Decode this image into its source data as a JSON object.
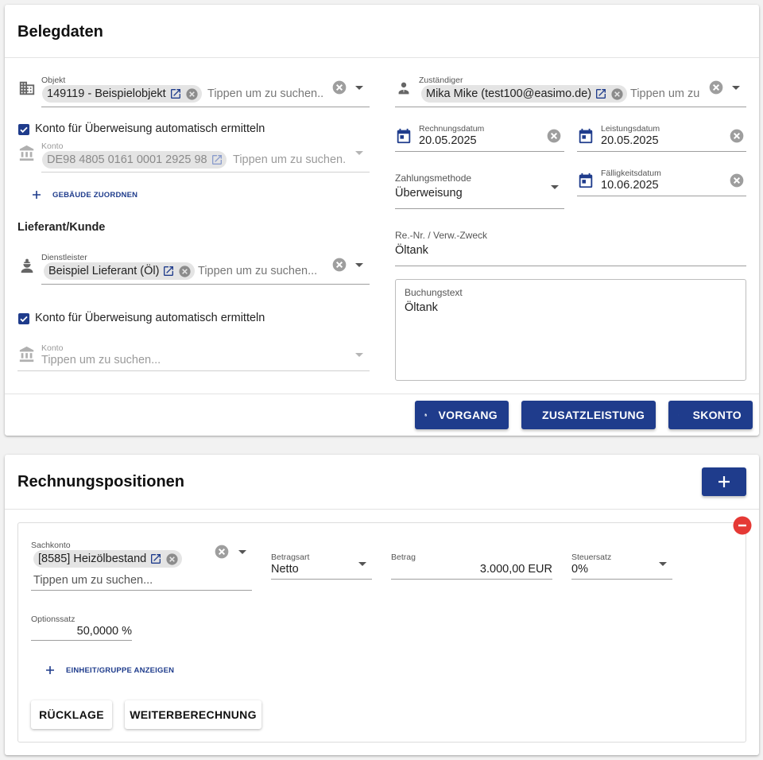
{
  "belegdaten": {
    "title": "Belegdaten",
    "objekt": {
      "label": "Objekt",
      "chip": "149119 - Beispielobjekt",
      "placeholder": "Tippen um zu suchen..",
      "icon": "building-icon"
    },
    "konto_auto_1": {
      "label": "Konto für Überweisung automatisch ermitteln",
      "checked": true
    },
    "konto_1": {
      "label": "Konto",
      "chip": "DE98 4805 0161 0001 2925 98",
      "placeholder": "Tippen um zu suchen.",
      "icon": "bank-icon"
    },
    "gebaeude_button": "GEBÄUDE ZUORDNEN",
    "lieferant_heading": "Lieferant/Kunde",
    "dienstleister": {
      "label": "Dienstleister",
      "chip": "Beispiel Lieferant (Öl)",
      "placeholder": "Tippen um zu suchen...",
      "icon": "worker-icon"
    },
    "konto_auto_2": {
      "label": "Konto für Überweisung automatisch ermitteln",
      "checked": true
    },
    "konto_2": {
      "label": "Konto",
      "placeholder": "Tippen um zu suchen...",
      "icon": "bank-icon"
    },
    "zustaendiger": {
      "label": "Zuständiger",
      "chip": "Mika Mike (test100@easimo.de)",
      "placeholder": "Tippen um zu",
      "icon": "person-icon"
    },
    "rechnungsdatum": {
      "label": "Rechnungsdatum",
      "value": "20.05.2025"
    },
    "leistungsdatum": {
      "label": "Leistungsdatum",
      "value": "20.05.2025"
    },
    "zahlungsmethode": {
      "label": "Zahlungsmethode",
      "value": "Überweisung"
    },
    "faelligkeitsdatum": {
      "label": "Fälligkeitsdatum",
      "value": "10.06.2025"
    },
    "re_nr": {
      "label": "Re.-Nr. / Verw.-Zweck",
      "value": "Öltank"
    },
    "buchungstext": {
      "label": "Buchungstext",
      "value": "Öltank"
    },
    "actions": {
      "vorgang": "VORGANG",
      "zusatzleistung": "ZUSATZLEISTUNG",
      "skonto": "SKONTO"
    }
  },
  "rechnungspositionen": {
    "title": "Rechnungspositionen",
    "add_icon": "plus-icon",
    "position": {
      "sachkonto": {
        "label": "Sachkonto",
        "chip": "[8585] Heizölbestand",
        "placeholder": "Tippen um zu suchen..."
      },
      "betragsart": {
        "label": "Betragsart",
        "value": "Netto"
      },
      "betrag": {
        "label": "Betrag",
        "value": "3.000,00 EUR"
      },
      "steuersatz": {
        "label": "Steuersatz",
        "value": "0%"
      },
      "optionssatz": {
        "label": "Optionssatz",
        "value": "50,0000 %"
      },
      "einheit_button": "EINHEIT/GRUPPE ANZEIGEN",
      "ruecklage_button": "RÜCKLAGE",
      "weiterberechnung_button": "WEITERBERECHNUNG"
    }
  },
  "colors": {
    "primary": "#1f3c8c",
    "danger": "#e53935"
  }
}
